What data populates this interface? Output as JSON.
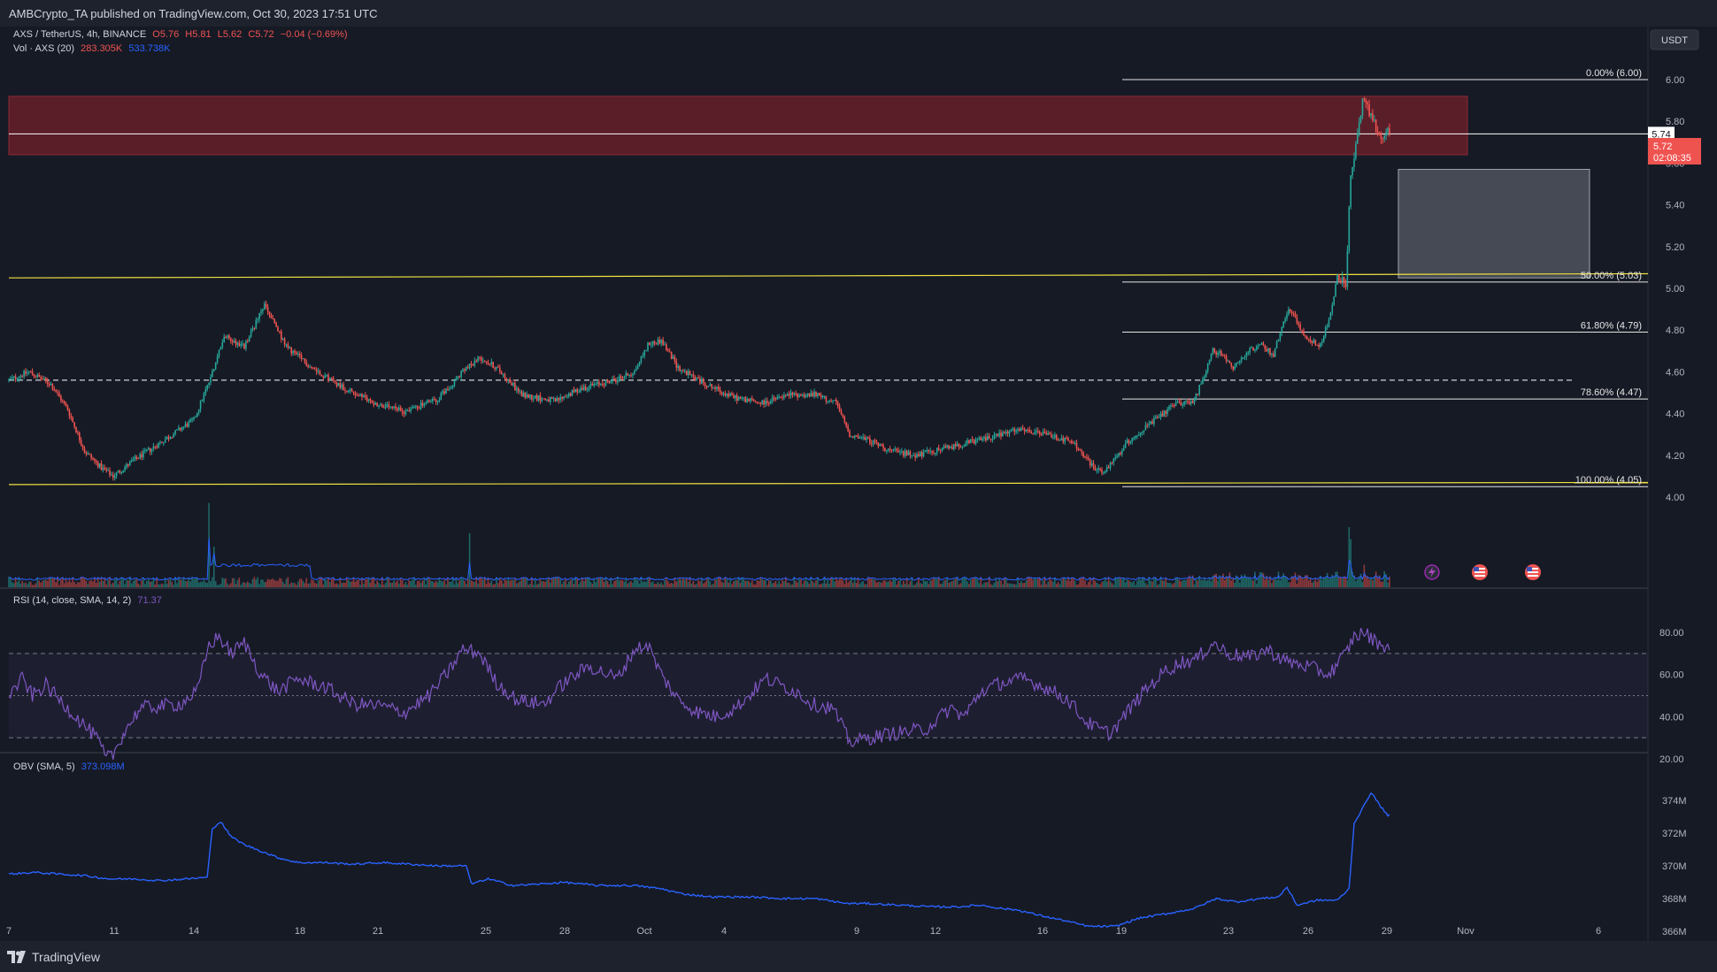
{
  "header": {
    "publisher": "AMBCrypto_TA published on TradingView.com, Oct 30, 2023 17:51 UTC"
  },
  "footer": {
    "brand": "TradingView"
  },
  "legend": {
    "symbol": "AXS / TetherUS, 4h, BINANCE",
    "open": "O5.76",
    "high": "H5.81",
    "low": "L5.62",
    "close": "C5.72",
    "change": "−0.04 (−0.69%)",
    "volume_label": "Vol · AXS (20)",
    "volume_value": "283.305K",
    "volume_ma": "533.738K",
    "rsi_label": "RSI (14, close, SMA, 14, 2)",
    "rsi_value": "71.37",
    "obv_label": "OBV (SMA, 5)",
    "obv_value": "373.098M"
  },
  "currency": "USDT",
  "price_markers": {
    "level_label": "5.74",
    "price_label": "5.72",
    "countdown": "02:08:35"
  },
  "colors": {
    "up": "#26a69a",
    "down": "#ef5350",
    "yellow": "#f0e040",
    "rsi": "#7e57c2",
    "obv": "#2962ff",
    "supply_zone": "#6b1f2a",
    "fvg_box": "#8a8d96"
  },
  "chart_data": [
    {
      "type": "candlestick",
      "title": "AXS / TetherUS, 4h, BINANCE",
      "ylim": [
        3.92,
        6.07
      ],
      "y_ticks": [
        "6.00",
        "5.80",
        "5.60",
        "5.40",
        "5.20",
        "5.00",
        "4.80",
        "4.60",
        "4.40",
        "4.20",
        "4.00"
      ],
      "x_ticks": [
        "7",
        "11",
        "14",
        "18",
        "21",
        "25",
        "28",
        "Oct",
        "4",
        "9",
        "12",
        "16",
        "19",
        "23",
        "26",
        "29",
        "Nov",
        "6"
      ],
      "fib_levels": [
        {
          "label": "0.00% (6.00)",
          "value": 6.0
        },
        {
          "label": "50.00% (5.03)",
          "value": 5.03
        },
        {
          "label": "61.80% (4.79)",
          "value": 4.79
        },
        {
          "label": "78.60% (4.47)",
          "value": 4.47
        },
        {
          "label": "100.00% (4.05)",
          "value": 4.05
        }
      ],
      "horizontal_levels": [
        5.74,
        4.56
      ],
      "zones": [
        {
          "name": "supply",
          "from": 5.64,
          "to": 5.92
        },
        {
          "name": "gap",
          "from": 5.05,
          "to": 5.57
        }
      ],
      "trendlines": [
        {
          "from": 5.05,
          "to": 5.07
        },
        {
          "from": 4.06,
          "to": 4.07
        }
      ],
      "anchors": [
        [
          0,
          4.56
        ],
        [
          12,
          4.6
        ],
        [
          25,
          4.54
        ],
        [
          35,
          4.42
        ],
        [
          45,
          4.22
        ],
        [
          55,
          4.14
        ],
        [
          62,
          4.1
        ],
        [
          75,
          4.18
        ],
        [
          90,
          4.26
        ],
        [
          110,
          4.37
        ],
        [
          119,
          4.55
        ],
        [
          128,
          4.77
        ],
        [
          140,
          4.72
        ],
        [
          152,
          4.92
        ],
        [
          165,
          4.72
        ],
        [
          180,
          4.62
        ],
        [
          200,
          4.52
        ],
        [
          220,
          4.44
        ],
        [
          235,
          4.41
        ],
        [
          255,
          4.47
        ],
        [
          270,
          4.6
        ],
        [
          280,
          4.67
        ],
        [
          290,
          4.62
        ],
        [
          305,
          4.49
        ],
        [
          325,
          4.46
        ],
        [
          340,
          4.52
        ],
        [
          360,
          4.56
        ],
        [
          372,
          4.6
        ],
        [
          380,
          4.73
        ],
        [
          388,
          4.75
        ],
        [
          398,
          4.62
        ],
        [
          410,
          4.56
        ],
        [
          430,
          4.48
        ],
        [
          448,
          4.45
        ],
        [
          465,
          4.49
        ],
        [
          480,
          4.49
        ],
        [
          492,
          4.45
        ],
        [
          500,
          4.3
        ],
        [
          512,
          4.27
        ],
        [
          525,
          4.22
        ],
        [
          540,
          4.2
        ],
        [
          560,
          4.24
        ],
        [
          580,
          4.28
        ],
        [
          600,
          4.32
        ],
        [
          618,
          4.3
        ],
        [
          633,
          4.26
        ],
        [
          645,
          4.14
        ],
        [
          652,
          4.12
        ],
        [
          665,
          4.26
        ],
        [
          680,
          4.36
        ],
        [
          695,
          4.45
        ],
        [
          705,
          4.46
        ],
        [
          716,
          4.7
        ],
        [
          722,
          4.68
        ],
        [
          728,
          4.62
        ],
        [
          738,
          4.7
        ],
        [
          745,
          4.73
        ],
        [
          752,
          4.68
        ],
        [
          758,
          4.85
        ],
        [
          762,
          4.9
        ],
        [
          770,
          4.78
        ],
        [
          779,
          4.72
        ],
        [
          785,
          4.84
        ],
        [
          790,
          5.06
        ],
        [
          795,
          5.02
        ],
        [
          798,
          5.55
        ],
        [
          800,
          5.62
        ],
        [
          805,
          5.9
        ],
        [
          810,
          5.83
        ],
        [
          816,
          5.72
        ],
        [
          820,
          5.75
        ]
      ],
      "volume_max_k": 6000,
      "volume_spikes": [
        [
          119,
          5600
        ],
        [
          122,
          2700
        ],
        [
          274,
          3600
        ],
        [
          797,
          4000
        ],
        [
          798,
          3200
        ],
        [
          806,
          1500
        ]
      ],
      "volume_ma_k": 533.738
    },
    {
      "type": "line",
      "title": "RSI (14, close, SMA, 14, 2)",
      "ylim": [
        15,
        85
      ],
      "y_ticks": [
        "80.00",
        "60.00",
        "40.00",
        "20.00"
      ],
      "bands": [
        30,
        50,
        70
      ],
      "anchors": [
        [
          0,
          50
        ],
        [
          8,
          58
        ],
        [
          14,
          50
        ],
        [
          22,
          55
        ],
        [
          30,
          48
        ],
        [
          40,
          40
        ],
        [
          52,
          30
        ],
        [
          58,
          20
        ],
        [
          62,
          22
        ],
        [
          68,
          32
        ],
        [
          78,
          44
        ],
        [
          90,
          45
        ],
        [
          102,
          46
        ],
        [
          112,
          52
        ],
        [
          119,
          74
        ],
        [
          125,
          78
        ],
        [
          132,
          70
        ],
        [
          140,
          75
        ],
        [
          150,
          60
        ],
        [
          160,
          52
        ],
        [
          172,
          58
        ],
        [
          188,
          54
        ],
        [
          205,
          46
        ],
        [
          222,
          45
        ],
        [
          235,
          42
        ],
        [
          250,
          50
        ],
        [
          262,
          62
        ],
        [
          270,
          72
        ],
        [
          280,
          70
        ],
        [
          290,
          56
        ],
        [
          302,
          48
        ],
        [
          318,
          46
        ],
        [
          330,
          56
        ],
        [
          345,
          64
        ],
        [
          362,
          58
        ],
        [
          372,
          72
        ],
        [
          380,
          74
        ],
        [
          388,
          60
        ],
        [
          398,
          48
        ],
        [
          410,
          42
        ],
        [
          420,
          40
        ],
        [
          432,
          44
        ],
        [
          440,
          50
        ],
        [
          450,
          58
        ],
        [
          468,
          52
        ],
        [
          478,
          46
        ],
        [
          490,
          44
        ],
        [
          500,
          28
        ],
        [
          512,
          30
        ],
        [
          525,
          32
        ],
        [
          545,
          34
        ],
        [
          560,
          44
        ],
        [
          568,
          40
        ],
        [
          578,
          52
        ],
        [
          590,
          56
        ],
        [
          604,
          58
        ],
        [
          616,
          54
        ],
        [
          630,
          48
        ],
        [
          640,
          38
        ],
        [
          648,
          34
        ],
        [
          655,
          32
        ],
        [
          665,
          42
        ],
        [
          675,
          52
        ],
        [
          688,
          62
        ],
        [
          698,
          66
        ],
        [
          706,
          67
        ],
        [
          716,
          75
        ],
        [
          725,
          70
        ],
        [
          738,
          68
        ],
        [
          748,
          72
        ],
        [
          760,
          66
        ],
        [
          772,
          64
        ],
        [
          785,
          60
        ],
        [
          795,
          70
        ],
        [
          800,
          78
        ],
        [
          806,
          80
        ],
        [
          812,
          76
        ],
        [
          820,
          73
        ]
      ],
      "last": 71.37
    },
    {
      "type": "line",
      "title": "OBV (SMA, 5)",
      "ylim": [
        365.6,
        375.0
      ],
      "y_ticks": [
        "374M",
        "372M",
        "370M",
        "368M",
        "366M"
      ],
      "anchors": [
        [
          0,
          369.5
        ],
        [
          15,
          369.6
        ],
        [
          30,
          369.5
        ],
        [
          45,
          369.4
        ],
        [
          60,
          369.2
        ],
        [
          75,
          369.2
        ],
        [
          90,
          369.1
        ],
        [
          105,
          369.2
        ],
        [
          118,
          369.3
        ],
        [
          121,
          372.3
        ],
        [
          126,
          372.7
        ],
        [
          132,
          371.8
        ],
        [
          140,
          371.3
        ],
        [
          150,
          370.9
        ],
        [
          160,
          370.5
        ],
        [
          172,
          370.2
        ],
        [
          188,
          370.2
        ],
        [
          205,
          370.1
        ],
        [
          222,
          370.2
        ],
        [
          255,
          370.0
        ],
        [
          272,
          370.0
        ],
        [
          275,
          368.9
        ],
        [
          285,
          369.2
        ],
        [
          300,
          368.8
        ],
        [
          318,
          368.9
        ],
        [
          330,
          369.0
        ],
        [
          350,
          368.8
        ],
        [
          372,
          368.8
        ],
        [
          388,
          368.6
        ],
        [
          400,
          368.3
        ],
        [
          418,
          368.1
        ],
        [
          440,
          368.1
        ],
        [
          462,
          368.0
        ],
        [
          480,
          368.0
        ],
        [
          498,
          367.7
        ],
        [
          510,
          367.7
        ],
        [
          530,
          367.6
        ],
        [
          548,
          367.5
        ],
        [
          565,
          367.5
        ],
        [
          578,
          367.6
        ],
        [
          590,
          367.4
        ],
        [
          600,
          367.3
        ],
        [
          612,
          367.0
        ],
        [
          630,
          366.6
        ],
        [
          642,
          366.3
        ],
        [
          658,
          366.3
        ],
        [
          672,
          366.8
        ],
        [
          690,
          367.1
        ],
        [
          705,
          367.4
        ],
        [
          718,
          368.0
        ],
        [
          730,
          367.8
        ],
        [
          744,
          368.0
        ],
        [
          755,
          368.1
        ],
        [
          760,
          368.7
        ],
        [
          766,
          367.6
        ],
        [
          778,
          367.9
        ],
        [
          790,
          367.9
        ],
        [
          797,
          368.6
        ],
        [
          800,
          372.6
        ],
        [
          805,
          373.5
        ],
        [
          810,
          374.5
        ],
        [
          816,
          373.6
        ],
        [
          820,
          373.1
        ]
      ],
      "last": 373.098
    }
  ]
}
